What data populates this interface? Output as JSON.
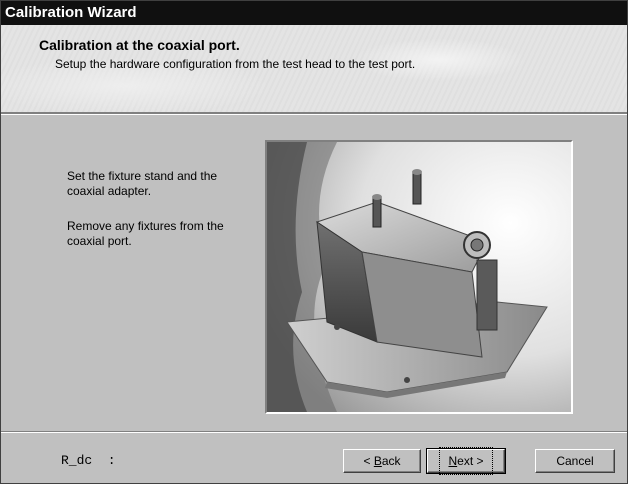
{
  "window": {
    "title": "Calibration Wizard"
  },
  "header": {
    "title": "Calibration at the coaxial port.",
    "subtitle": "Setup the hardware configuration from the test head to the test port."
  },
  "instructions": {
    "step1": "Set the fixture stand and the coaxial adapter.",
    "step2": "Remove any fixtures from the coaxial port."
  },
  "image": {
    "subject": "fixture-stand-photo"
  },
  "status": {
    "label": "R_dc  :"
  },
  "buttons": {
    "back": {
      "prefix": "< ",
      "accel": "B",
      "rest": "ack"
    },
    "next": {
      "accel": "N",
      "rest": "ext >"
    },
    "cancel": "Cancel"
  }
}
